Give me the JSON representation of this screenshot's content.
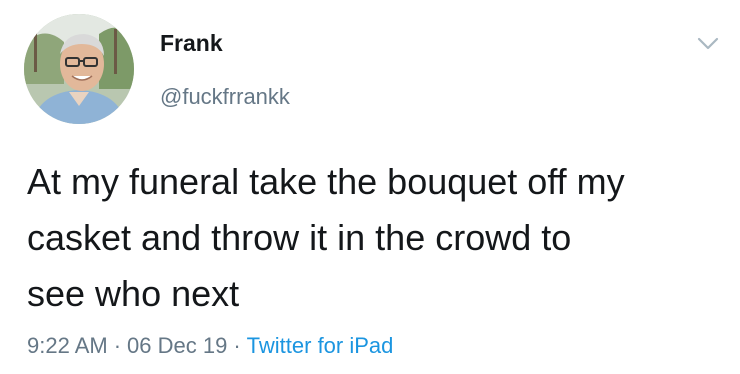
{
  "tweet": {
    "display_name": "Frank",
    "handle": "@fuckfrrankk",
    "text_lines": [
      "At my funeral take the bouquet off my",
      "casket and throw it in the crowd to",
      "see who next"
    ],
    "time": "9:22 AM",
    "date": "06 Dec 19",
    "separator": "·",
    "source": "Twitter for iPad",
    "more_icon": "chevron-down-icon",
    "avatar_icon": "avatar"
  },
  "colors": {
    "text": "#14171a",
    "secondary": "#657786",
    "link": "#1b95e0",
    "background": "#ffffff"
  }
}
